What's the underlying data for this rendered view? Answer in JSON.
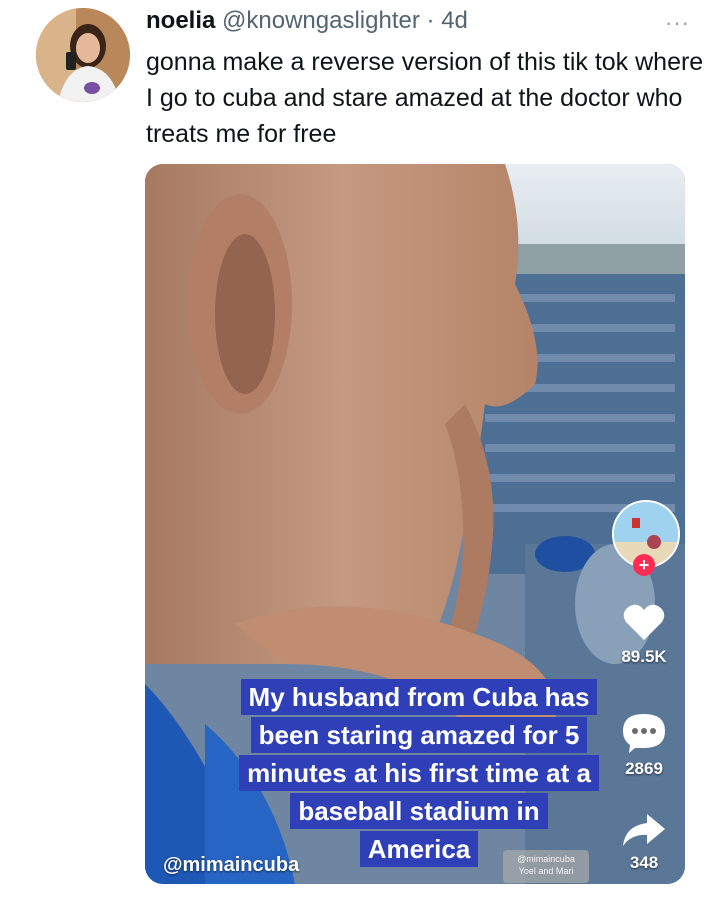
{
  "tweet": {
    "display_name": "noelia",
    "handle": "@knowngaslighter",
    "separator": "·",
    "time": "4d",
    "more": "···",
    "text": "gonna make a reverse version of this tik tok where I go to cuba and stare amazed at the doctor who treats me for free"
  },
  "tiktok": {
    "caption_lines": [
      "My husband from Cuba has",
      "been staring amazed for 5",
      "minutes at his first time at a",
      "baseball stadium in",
      "America"
    ],
    "creator_handle": "@mimaincuba",
    "watermark_line1": "@mimaincuba",
    "watermark_line2": "Yoel and Mari",
    "likes": "89.5K",
    "comments": "2869",
    "shares": "348",
    "follow_symbol": "+"
  },
  "colors": {
    "caption_bg": "#2f3fb8",
    "follow_red": "#fe2c55",
    "handle_gray": "#536471"
  }
}
